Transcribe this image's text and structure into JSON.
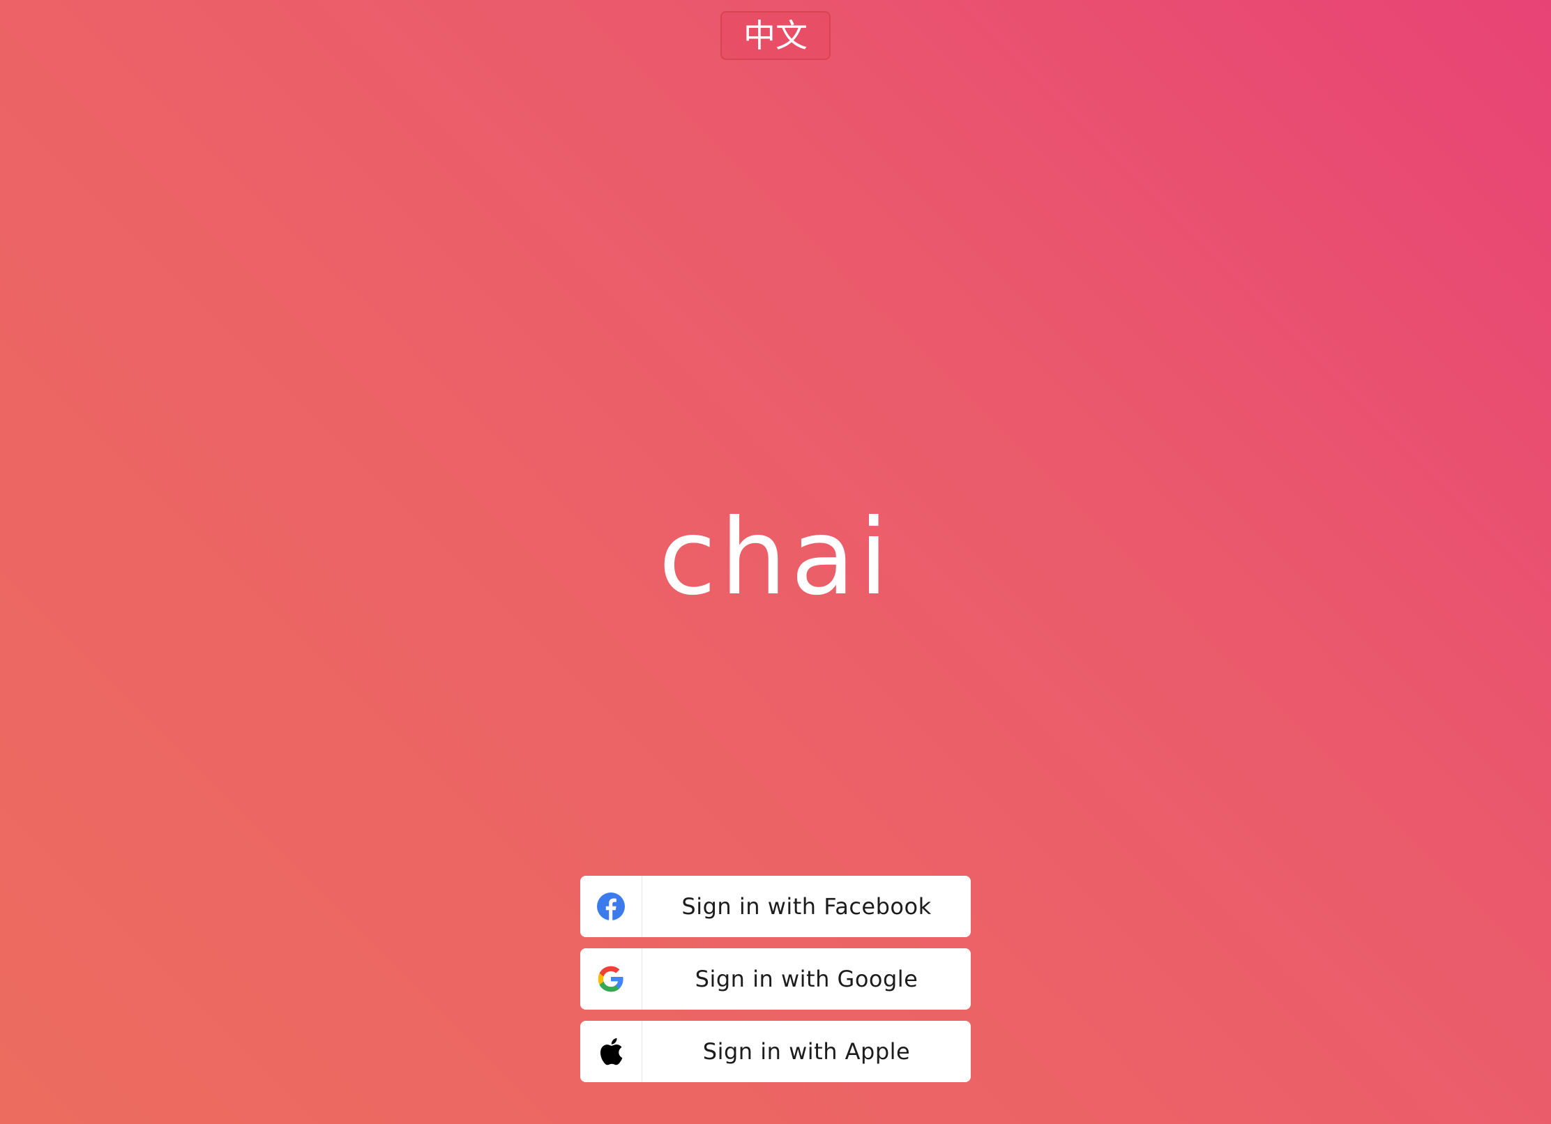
{
  "header": {
    "language_toggle_label": "中文"
  },
  "brand": {
    "logo_text": "chai"
  },
  "signin": {
    "buttons": [
      {
        "label": "Sign in with Facebook",
        "icon": "facebook-icon"
      },
      {
        "label": "Sign in with Google",
        "icon": "google-icon"
      },
      {
        "label": "Sign in with Apple",
        "icon": "apple-icon"
      }
    ]
  },
  "colors": {
    "background_start": "#ec6c5f",
    "background_end": "#e84375",
    "button_background": "#ffffff",
    "facebook_blue": "#3b7bec"
  }
}
